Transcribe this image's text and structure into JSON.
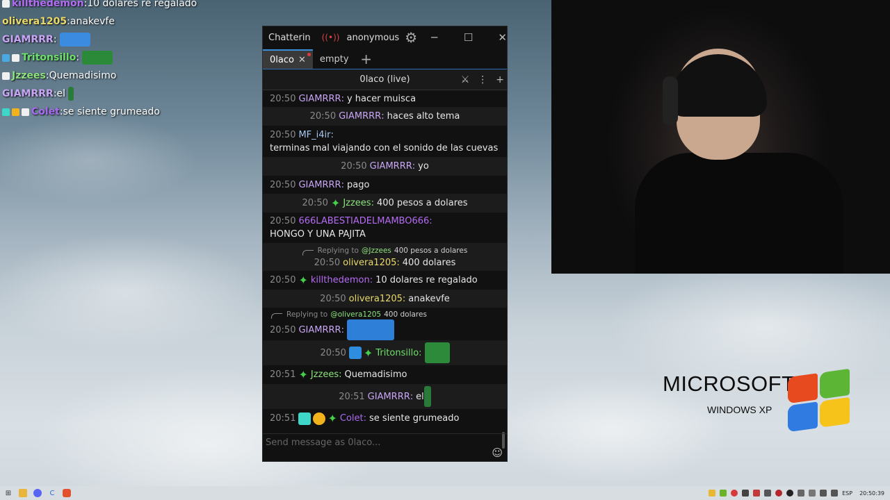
{
  "overlay": {
    "lines": [
      {
        "name": "killthedemon",
        "message": "10 dolares re regalado",
        "color": "#b56cf5",
        "badges": [
          "#f0f0f0"
        ]
      },
      {
        "name": "olivera1205",
        "message": "anakevfe",
        "color": "#e8d96a",
        "badges": []
      },
      {
        "name": "GIAMRRR",
        "message": "",
        "color": "#c9a6f5",
        "badges": [],
        "emote": "#3b8be0"
      },
      {
        "name": "Tritonsillo",
        "message": "",
        "color": "#6de06a",
        "badges": [
          "#4aa9e0",
          "#f0f0f0"
        ],
        "emote": "#2a8a3a"
      },
      {
        "name": "Jzzees",
        "message": "Quemadisimo",
        "color": "#8ee27e",
        "badges": [
          "#f0f0f0"
        ]
      },
      {
        "name": "GIAMRRR",
        "message": "el",
        "color": "#c9a6f5",
        "badges": [],
        "emote_small": "#2a7a3a"
      },
      {
        "name": "Colet",
        "message": "se siente grumeado",
        "color": "#a76bf0",
        "badges": [
          "#3dd6c9",
          "#f1b21c",
          "#f0f0f0"
        ]
      }
    ]
  },
  "window": {
    "app_name": "Chatterin",
    "live_icon": "((•))",
    "user": "anonymous",
    "settings_icon": "gear-icon",
    "minimize": "─",
    "maximize": "☐",
    "close": "✕"
  },
  "tabs": [
    {
      "label": "0laco",
      "active": true,
      "close": "✕"
    },
    {
      "label": "empty",
      "active": false
    }
  ],
  "tab_add": "+",
  "split": {
    "title": "0laco (live)",
    "moderation_icon": "sword-icon",
    "menu_icon": "⋮",
    "add_icon": "+"
  },
  "messages": [
    {
      "time": "20:50",
      "name": "GIAMRRR",
      "color": "#c9a6f5",
      "text": "y hacer muisca",
      "h": 24
    },
    {
      "time": "20:50",
      "name": "GIAMRRR",
      "color": "#c9a6f5",
      "text": "haces alto tema",
      "h": 27,
      "alt": true
    },
    {
      "time": "20:50",
      "name": "MF_i4ir",
      "color": "#a7c7ee",
      "text": "terminas mal viajando con el sonido de las cuevas",
      "h": 45
    },
    {
      "time": "20:50",
      "name": "GIAMRRR",
      "color": "#c9a6f5",
      "text": "yo",
      "h": 27,
      "alt": true
    },
    {
      "time": "20:50",
      "name": "GIAMRRR",
      "color": "#c9a6f5",
      "text": "pago",
      "h": 26
    },
    {
      "time": "20:50",
      "name": "Jzzees",
      "color": "#8ee27e",
      "text": "400 pesos a dolares",
      "h": 27,
      "alt": true,
      "star": true
    },
    {
      "time": "20:50",
      "name": "666LABESTIADELMAMBO666",
      "color": "#b56cf5",
      "text": "HONGO Y UNA PAJITA",
      "h": 44
    },
    {
      "reply_to": "@Jzzees",
      "reply_text": "400 pesos a dolares",
      "time": "20:50",
      "name": "olivera1205",
      "color": "#e8d96a",
      "text": "400 dolares",
      "h": 40,
      "alt": true
    },
    {
      "time": "20:50",
      "name": "killthedemon",
      "color": "#b56cf5",
      "text": "10 dolares re regalado",
      "h": 27,
      "star": true
    },
    {
      "time": "20:50",
      "name": "olivera1205",
      "color": "#e8d96a",
      "text": "anakevfe",
      "h": 26,
      "alt": true
    },
    {
      "reply_to": "@olivera1205",
      "reply_text": "400 dolares",
      "time": "20:50",
      "name": "GIAMRRR",
      "color": "#c9a6f5",
      "text": "",
      "h": 47,
      "emote": {
        "w": 68,
        "h": 30,
        "color": "#2e7fd8"
      }
    },
    {
      "time": "20:50",
      "name": "Tritonsillo",
      "color": "#6de06a",
      "text": "",
      "h": 36,
      "alt": true,
      "badges": [
        "#2f8de0"
      ],
      "star": true,
      "emote": {
        "w": 36,
        "h": 30,
        "color": "#2c8a3a"
      }
    },
    {
      "time": "20:51",
      "name": "Jzzees",
      "color": "#8ee27e",
      "text": "Quemadisimo",
      "h": 27,
      "star": true
    },
    {
      "time": "20:51",
      "name": "GIAMRRR",
      "color": "#c9a6f5",
      "text": "el",
      "h": 36,
      "alt": true,
      "emote": {
        "w": 10,
        "h": 30,
        "color": "#2a7a3a"
      }
    },
    {
      "time": "20:51",
      "name": "Colet",
      "color": "#a76bf0",
      "text": "se siente grumeado",
      "h": 27,
      "badges": [
        "#3dd6c9",
        "#f1b21c"
      ],
      "star": true
    }
  ],
  "input": {
    "placeholder": "Send message as 0laco...",
    "emoji_icon": "☺"
  },
  "xp": {
    "brand": "MICROSOFT",
    "product": "WINDOWS XP"
  },
  "taskbar": {
    "language": "ESP",
    "clock": "20:50:39"
  }
}
